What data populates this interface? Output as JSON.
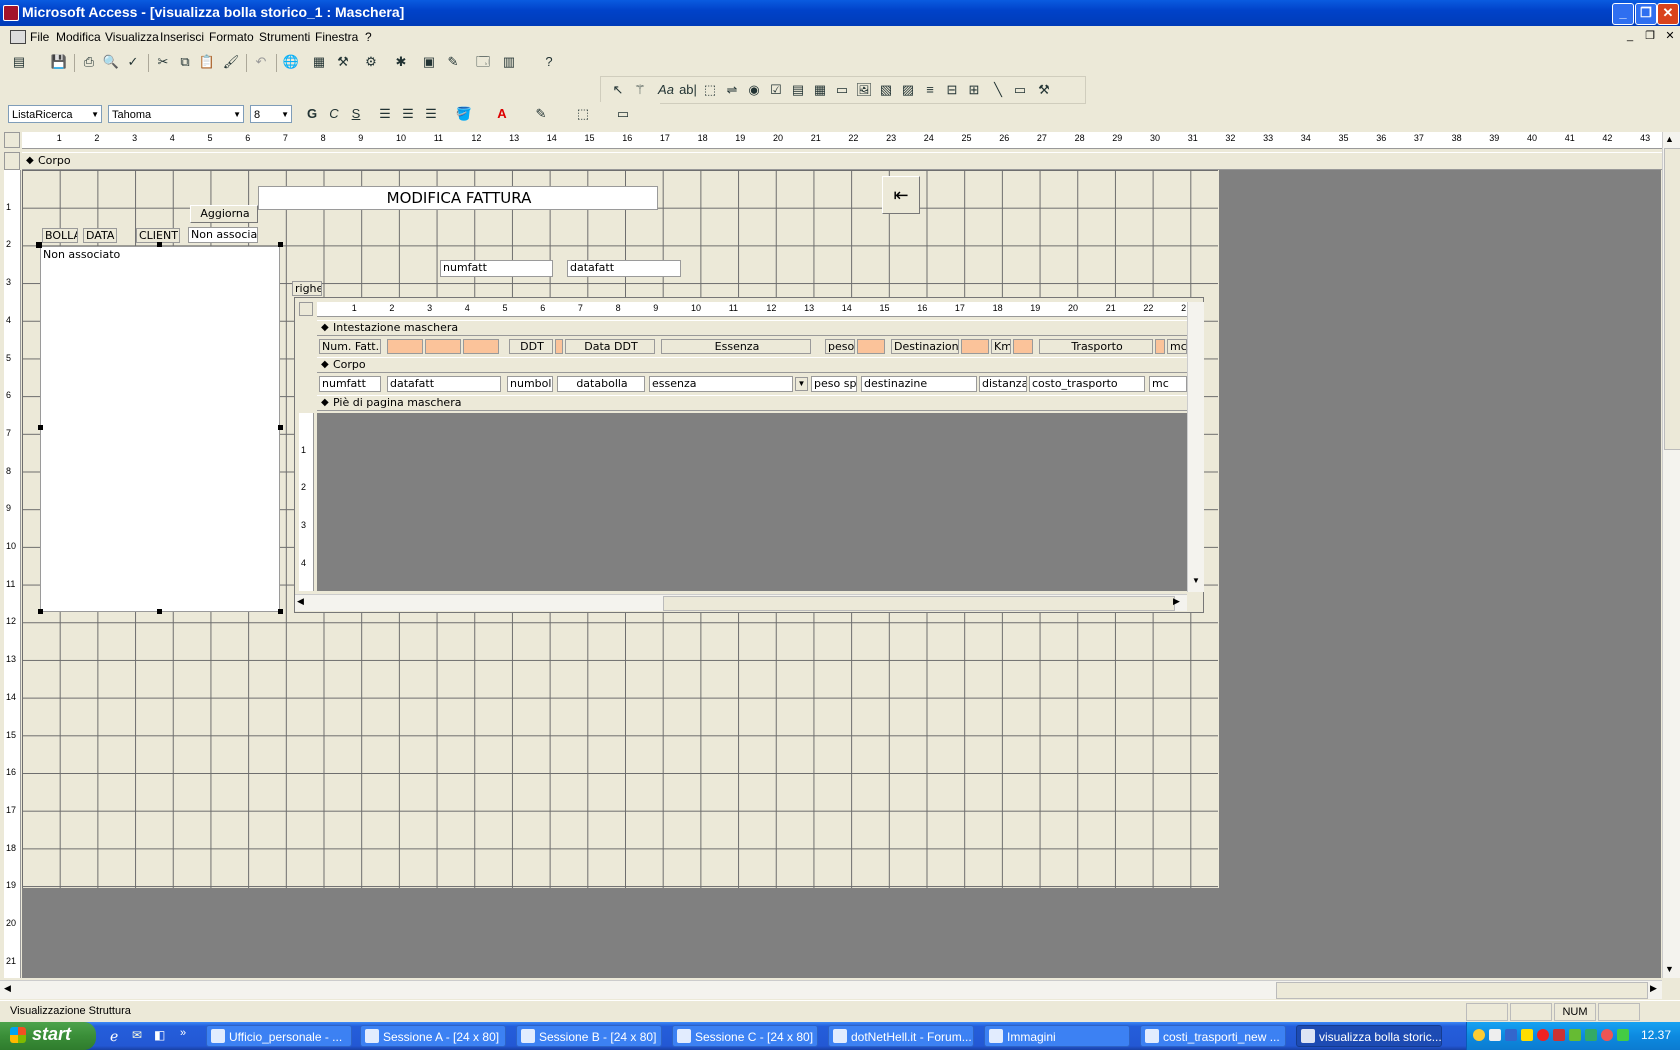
{
  "window": {
    "title": "Microsoft Access - [visualizza bolla storico_1 : Maschera]"
  },
  "menu": [
    "File",
    "Modifica",
    "Visualizza",
    "Inserisci",
    "Formato",
    "Strumenti",
    "Finestra",
    "?"
  ],
  "format_toolbar": {
    "object_combo": "ListaRicerca",
    "font_combo": "Tahoma",
    "size_combo": "8",
    "bold": "G",
    "italic": "C",
    "underline": "S"
  },
  "ruler_top": [
    "1",
    "2",
    "3",
    "4",
    "5",
    "6",
    "7",
    "8",
    "9",
    "10",
    "11",
    "12",
    "13",
    "14",
    "15",
    "16",
    "17",
    "18",
    "19",
    "20",
    "21",
    "22",
    "23",
    "24",
    "25",
    "26",
    "27",
    "28",
    "29",
    "30",
    "31",
    "32",
    "33",
    "34",
    "35",
    "36",
    "37",
    "38",
    "39",
    "40",
    "41",
    "42",
    "43"
  ],
  "ruler_left": [
    "1",
    "2",
    "3",
    "4",
    "5",
    "6",
    "7",
    "8",
    "9",
    "10",
    "11",
    "12",
    "13",
    "14",
    "15",
    "16",
    "17",
    "18",
    "19",
    "20",
    "21"
  ],
  "form": {
    "section_body": "Corpo",
    "title_label": "MODIFICA FATTURA",
    "aggiorna_button": "Aggiorna",
    "col_labels": [
      "BOLLA",
      "DATA",
      "CLIENTE"
    ],
    "combo_unbound": "Non associatc",
    "list_unbound": "Non associato",
    "numfatt": "numfatt",
    "datafatt": "datafatt",
    "righe_label": "righe"
  },
  "subform": {
    "ruler": [
      "1",
      "2",
      "3",
      "4",
      "5",
      "6",
      "7",
      "8",
      "9",
      "10",
      "11",
      "12",
      "13",
      "14",
      "15",
      "16",
      "17",
      "18",
      "19",
      "20",
      "21",
      "22",
      "2"
    ],
    "ruler_left": [
      "1",
      "2",
      "3",
      "4"
    ],
    "header_section": "Intestazione maschera",
    "body_section": "Corpo",
    "footer_section": "Piè di pagina maschera",
    "header_labels": [
      "Num. Fatt.",
      "DDT",
      "Data DDT",
      "Essenza",
      "peso",
      "Destinazione",
      "Km",
      "Trasporto",
      "mc"
    ],
    "body_fields": [
      "numfatt",
      "datafatt",
      "numboll",
      "databolla",
      "essenza",
      "peso spe",
      "destinazine",
      "distanza",
      "costo_trasporto",
      "mc"
    ]
  },
  "status": {
    "left": "Visualizzazione Struttura",
    "num": "NUM"
  },
  "taskbar": {
    "start": "start",
    "tasks": [
      "Ufficio_personale - ...",
      "Sessione A - [24 x 80]",
      "Sessione B - [24 x 80]",
      "Sessione C - [24 x 80]",
      "dotNetHell.it - Forum...",
      "Immagini",
      "costi_trasporti_new ...",
      "visualizza bolla storic..."
    ],
    "clock": "12.37"
  },
  "colors": {
    "accent_orange": "#fbc39a",
    "title_blue": "#0042c9",
    "taskbar_blue": "#245edb"
  }
}
